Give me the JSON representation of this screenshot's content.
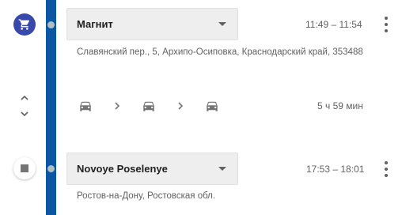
{
  "stops": [
    {
      "place": "Магнит",
      "time_range": "11:49 – 11:54",
      "address": "Славянский пер., 5, Архипо-Осиповка, Краснодарский край, 353488",
      "icon": "shopping-cart-icon"
    },
    {
      "place": "Novoye Poselenye",
      "time_range": "17:53 – 18:01",
      "address": "Ростов-на-Дону, Ростовская обл.",
      "icon": "stop-icon"
    }
  ],
  "transit": {
    "duration": "5 ч 59 мин",
    "segments": [
      "car-icon",
      "car-icon",
      "car-icon"
    ]
  },
  "colors": {
    "timeline": "#0b57a4",
    "cart_circle": "#3949ab",
    "field_bg": "#eeeeee",
    "secondary_text": "#616161"
  }
}
